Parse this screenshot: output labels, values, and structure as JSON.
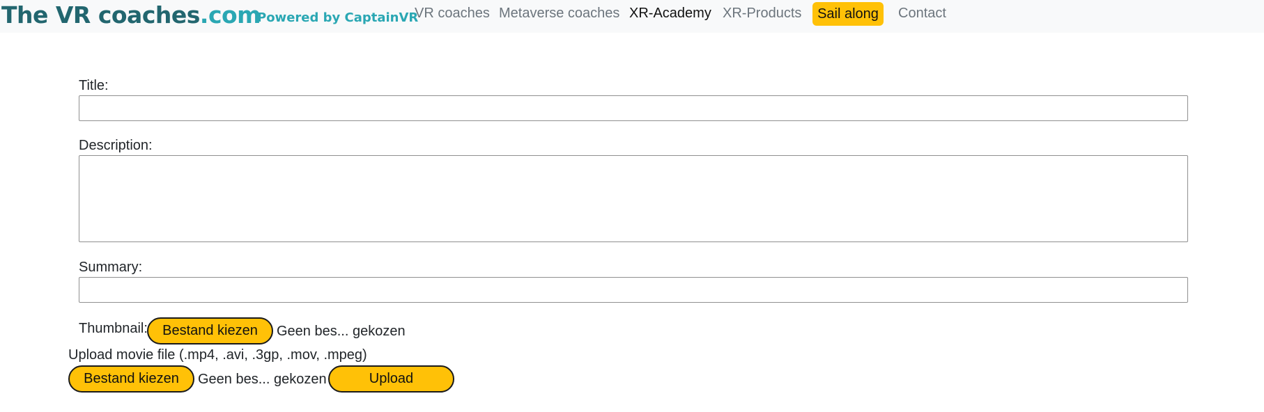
{
  "navbar": {
    "brand_main": "The VR coaches",
    "brand_tld": ".com",
    "powered_by": "Powered by CaptainVR",
    "links": [
      {
        "label": "VR coaches"
      },
      {
        "label": "Metaverse coaches"
      },
      {
        "label": "XR-Academy",
        "active": true
      },
      {
        "label": "XR-Products"
      },
      {
        "label": "Sail along"
      },
      {
        "label": "Contact"
      }
    ]
  },
  "form": {
    "title_label": "Title:",
    "title_value": "",
    "description_label": "Description:",
    "description_value": "",
    "summary_label": "Summary:",
    "summary_value": "",
    "thumbnail_label": "Thumbnail:",
    "thumbnail_button": "Bestand kiezen",
    "thumbnail_status": "Geen bes... gekozen",
    "movie_label": "Upload movie file (.mp4, .avi, .3gp, .mov, .mpeg)",
    "movie_button": "Bestand kiezen",
    "movie_status": "Geen bes... gekozen",
    "upload_button": "Upload"
  },
  "colors": {
    "accent": "#ffc107",
    "brand_dark": "#22666f",
    "brand_light": "#2aa7b3",
    "navbar_bg": "#f8f9fa"
  }
}
